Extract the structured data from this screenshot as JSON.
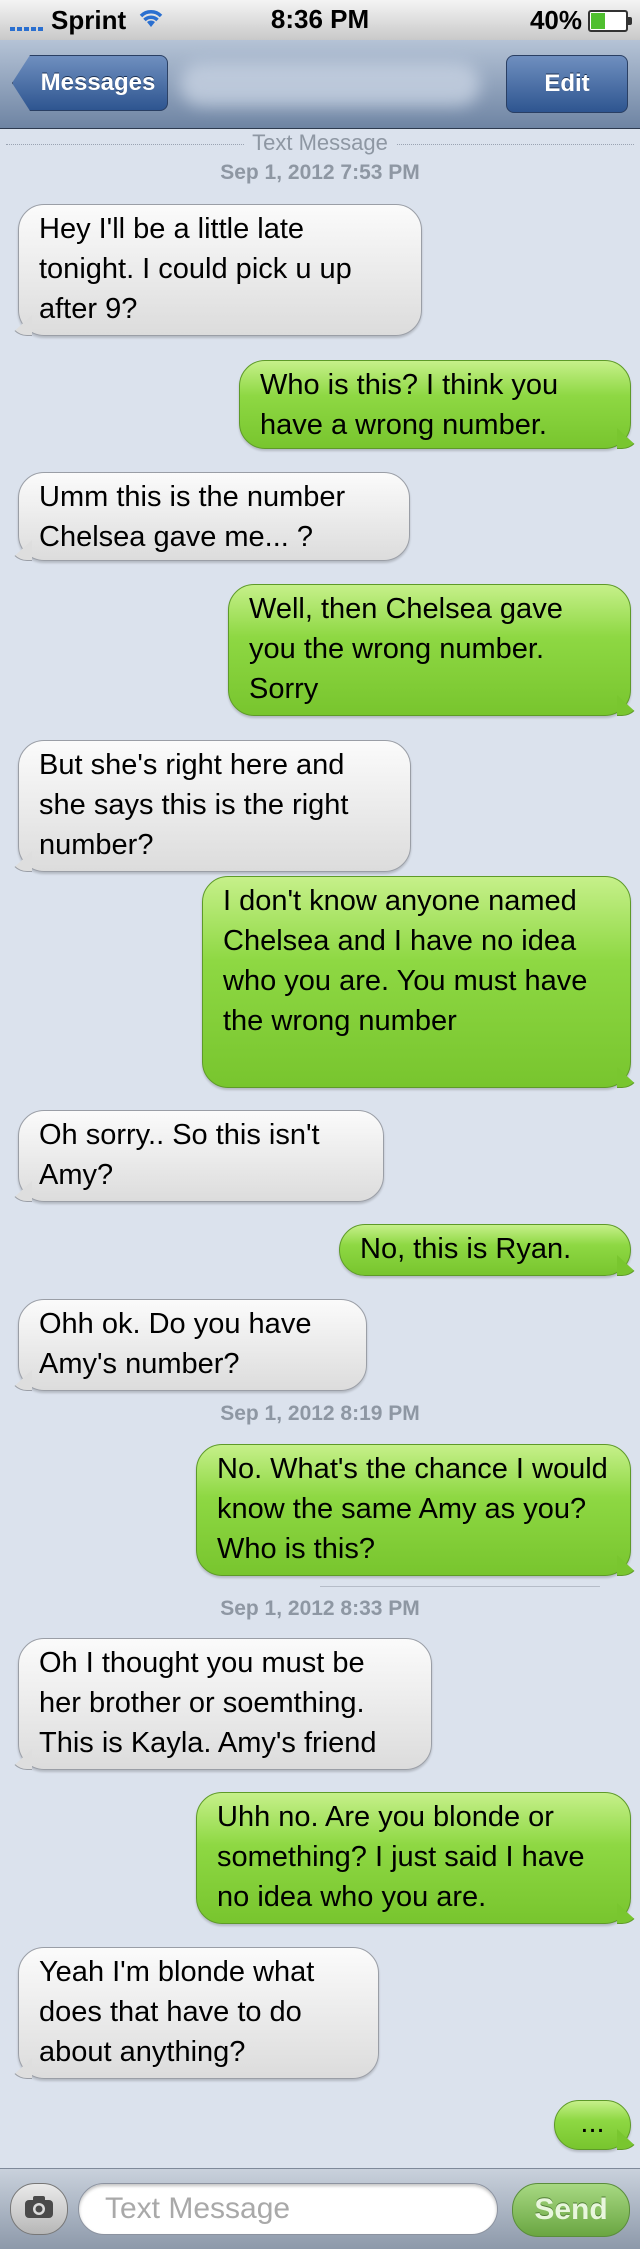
{
  "status_bar": {
    "carrier": "Sprint",
    "time": "8:36 PM",
    "battery": "40%",
    "battery_level": 0.4
  },
  "nav": {
    "back_label": "Messages",
    "edit_label": "Edit"
  },
  "thread": {
    "label": "Text Message",
    "timestamps": [
      "Sep 1, 2012 7:53 PM",
      "Sep 1, 2012 8:19 PM",
      "Sep 1, 2012 8:33 PM"
    ],
    "messages": [
      {
        "dir": "in",
        "text": "Hey I'll be a little late tonight. I could pick u up after 9?"
      },
      {
        "dir": "out",
        "text": "Who is this? I think you have a wrong number."
      },
      {
        "dir": "in",
        "text": "Umm this is the number Chelsea gave me... ?"
      },
      {
        "dir": "out",
        "text": "Well, then Chelsea gave you the wrong number. Sorry"
      },
      {
        "dir": "in",
        "text": "But she's right here and she says this is the right number?"
      },
      {
        "dir": "out",
        "text": "I don't know anyone named Chelsea and I have no idea who you are. You must have the wrong number"
      },
      {
        "dir": "in",
        "text": "Oh sorry.. So this isn't Amy?"
      },
      {
        "dir": "out",
        "text": "No, this is Ryan."
      },
      {
        "dir": "in",
        "text": "Ohh ok. Do you have Amy's number?"
      },
      {
        "dir": "out",
        "text": "No. What's the chance I would know the same Amy as you? Who is this?"
      },
      {
        "dir": "in",
        "text": "Oh I thought you must be her brother or soemthing. This is Kayla. Amy's friend"
      },
      {
        "dir": "out",
        "text": "Uhh no. Are you blonde or something? I just said I have no idea who you are."
      },
      {
        "dir": "in",
        "text": "Yeah I'm blonde what does that have to do about anything?"
      },
      {
        "dir": "out",
        "text": "..."
      }
    ]
  },
  "input_bar": {
    "placeholder": "Text Message",
    "send_label": "Send"
  }
}
